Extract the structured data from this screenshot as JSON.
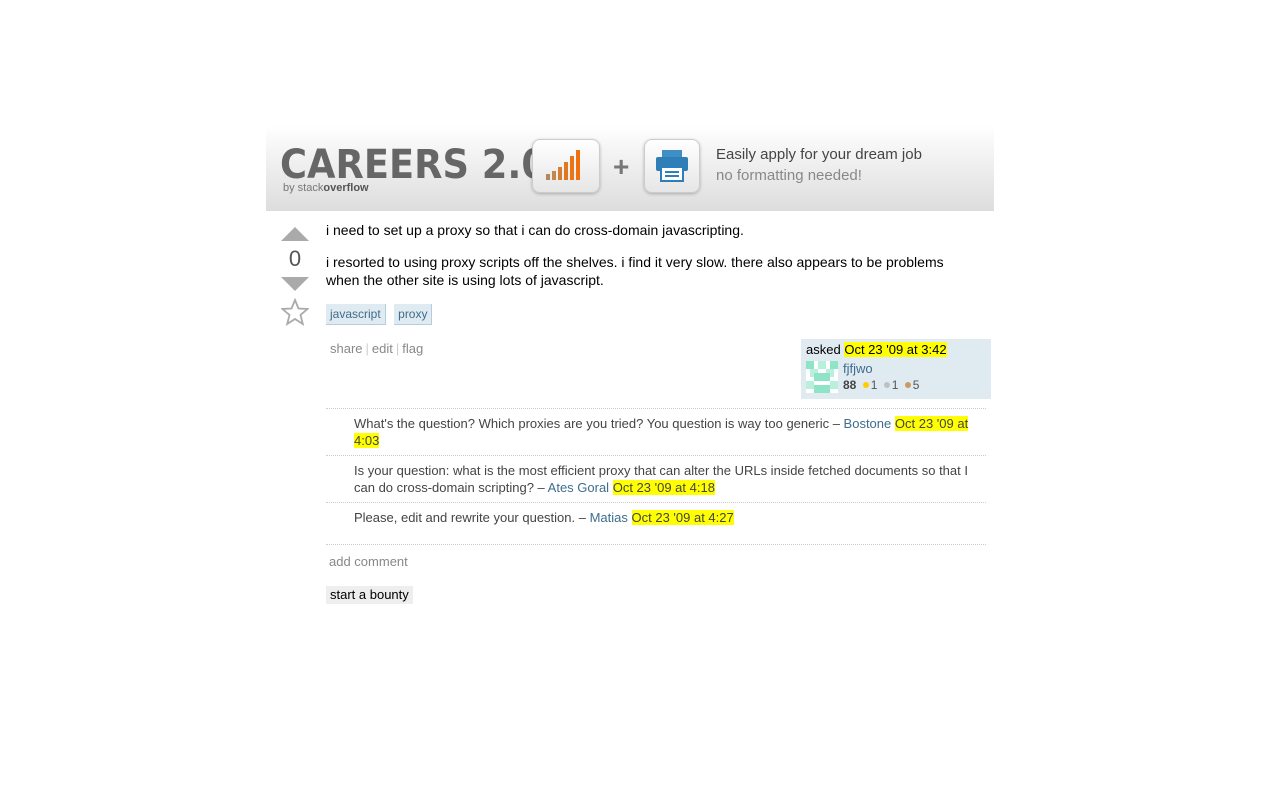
{
  "banner": {
    "title": "CAREERS 2.0",
    "by_prefix": "by stack",
    "by_suffix": "overflow",
    "plus": "+",
    "tagline_1": "Easily apply for your dream job",
    "tagline_2": "no formatting needed!"
  },
  "question": {
    "vote_count": "0",
    "paragraphs": [
      "i need to set up a proxy so that i can do cross-domain javascripting.",
      "i resorted to using proxy scripts off the shelves. i find it very slow. there also appears to be problems when the other site is using lots of javascript."
    ],
    "tags": [
      "javascript",
      "proxy"
    ],
    "menu": {
      "share": "share",
      "edit": "edit",
      "flag": "flag",
      "separator": "|"
    },
    "owner": {
      "asked_label": "asked",
      "asked_time": "Oct 23 '09 at 3:42",
      "user": "fjfjwo",
      "rep": "88",
      "gold": "1",
      "silver": "1",
      "bronze": "5"
    }
  },
  "comments": [
    {
      "text": "What's the question? Which proxies are you tried? You question is way too generic – ",
      "user": "Bostone",
      "time": "Oct 23 '09 at 4:03"
    },
    {
      "text": "Is your question: what is the most efficient proxy that can alter the URLs inside fetched documents so that I can do cross-domain scripting? – ",
      "user": "Ates Goral",
      "time": "Oct 23 '09 at 4:18"
    },
    {
      "text": "Please, edit and rewrite your question. – ",
      "user": "Matias",
      "time": "Oct 23 '09 at 4:27"
    }
  ],
  "actions": {
    "add_comment": "add comment",
    "start_bounty": "start a bounty"
  },
  "colors": {
    "link": "#3e6d8e",
    "highlight": "#ffff00",
    "tag_bg": "#e0eaf1",
    "gold": "#ffcc00",
    "silver": "#c0c0c0",
    "bronze": "#cc9966",
    "chart_bars": "#e8751a"
  }
}
